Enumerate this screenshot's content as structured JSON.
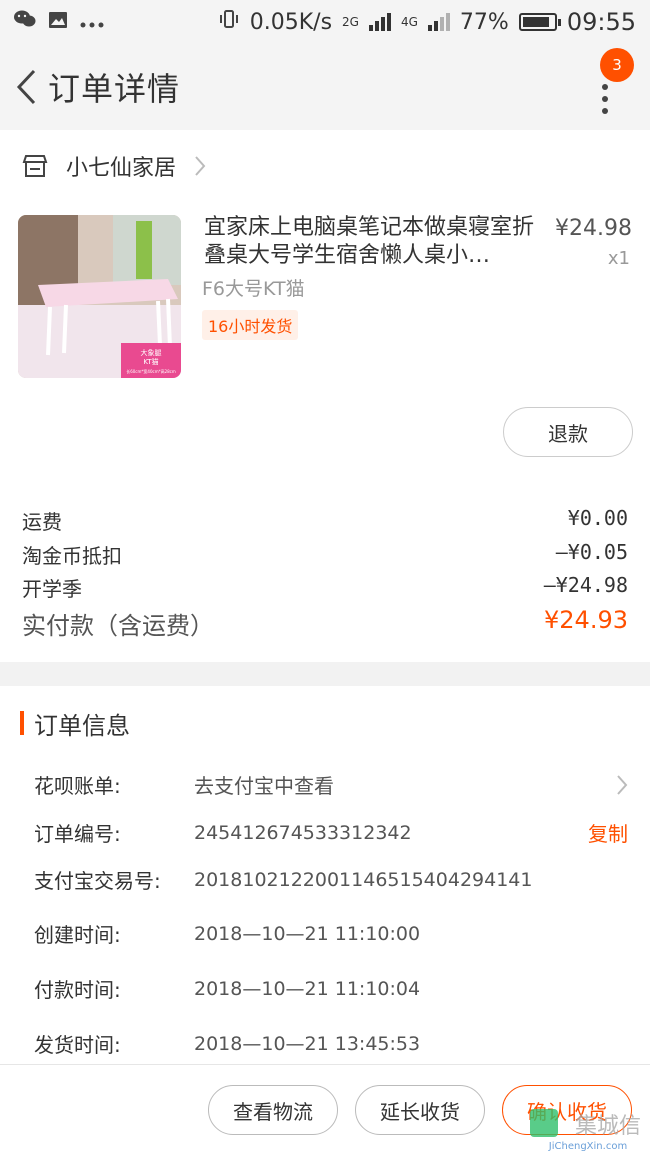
{
  "status_bar": {
    "speed": "0.05K/s",
    "net1": "2G",
    "net2": "4G",
    "battery": "77%",
    "time": "09:55"
  },
  "header": {
    "title": "订单详情",
    "badge_count": "3"
  },
  "shop": {
    "name": "小七仙家居"
  },
  "product": {
    "title": "宜家床上电脑桌笔记本做桌寝室折叠桌大号学生宿舍懒人桌小…",
    "price": "¥24.98",
    "qty": "x1",
    "sku": "F6大号KT猫",
    "ship_tag": "16小时发货",
    "thumb_text1": "大象腿",
    "thumb_text2": "KT猫",
    "thumb_text3": "长60cm*宽40cm*高28cm"
  },
  "refund_label": "退款",
  "fees": [
    {
      "label": "运费",
      "value": "¥0.00"
    },
    {
      "label": "淘金币抵扣",
      "value": "—¥0.05"
    },
    {
      "label": "开学季",
      "value": "—¥24.98"
    }
  ],
  "total": {
    "label": "实付款（含运费）",
    "value": "¥24.93"
  },
  "order_info": {
    "title": "订单信息",
    "rows": [
      {
        "label": "花呗账单:",
        "value": "去支付宝中查看"
      },
      {
        "label": "订单编号:",
        "value": "245412674533312342",
        "action": "复制"
      },
      {
        "label": "支付宝交易号:",
        "value": "2018102122001146515404294141"
      },
      {
        "label": "创建时间:",
        "value": "2018—10—21 11:10:00"
      },
      {
        "label": "付款时间:",
        "value": "2018—10—21 11:10:04"
      },
      {
        "label": "发货时间:",
        "value": "2018—10—21 13:45:53"
      }
    ]
  },
  "bottom": {
    "logistics": "查看物流",
    "extend": "延长收货",
    "confirm": "确认收货"
  },
  "watermark": {
    "brand": "集城信",
    "url": "JiChengXin.com"
  },
  "colors": {
    "accent": "#ff5000"
  }
}
